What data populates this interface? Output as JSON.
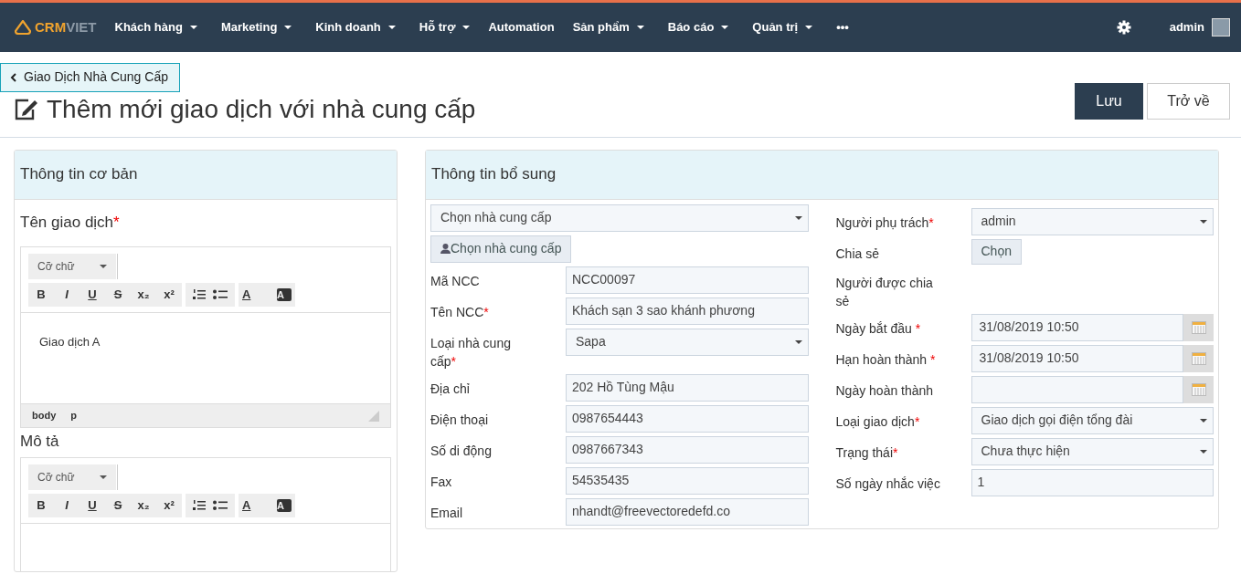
{
  "navbar": {
    "logo": {
      "primary": "CRM",
      "secondary": "VIET"
    },
    "menu": [
      {
        "label": "Khách hàng",
        "dropdown": true
      },
      {
        "label": "Marketing",
        "dropdown": true
      },
      {
        "label": "Kinh doanh",
        "dropdown": true
      },
      {
        "label": "Hỗ trợ",
        "dropdown": true
      },
      {
        "label": "Automation",
        "dropdown": false
      },
      {
        "label": "Sản phẩm",
        "dropdown": true
      },
      {
        "label": "Báo cáo",
        "dropdown": true
      },
      {
        "label": "Quản trị",
        "dropdown": true
      },
      {
        "label": "•••",
        "dropdown": false
      }
    ],
    "user": "admin"
  },
  "breadcrumb": {
    "label": "Giao Dịch Nhà Cung Cấp"
  },
  "page_title": "Thêm mới giao dịch với nhà cung cấp",
  "actions": [
    {
      "label": "Lưu",
      "kind": "primary"
    },
    {
      "label": "Trở về",
      "kind": "default"
    }
  ],
  "basic_panel": {
    "title": "Thông tin cơ bản",
    "editors": [
      {
        "label": "Tên giao dịch",
        "mark": "*",
        "font_size": "Cỡ chữ",
        "format_buttons": [
          "B",
          "I",
          "U",
          "S",
          "x₂",
          "x²"
        ],
        "color_buttons": [
          "A",
          "A"
        ],
        "content": "Giao dịch A",
        "path": [
          "body",
          "p"
        ]
      },
      {
        "label": "Mô tả",
        "font_size": "Cỡ chữ",
        "format_buttons": [
          "B",
          "I",
          "U",
          "S",
          "x₂",
          "x²"
        ],
        "color_buttons": [
          "A",
          "A"
        ]
      }
    ]
  },
  "extra_panel": {
    "title": "Thông tin bổ sung",
    "supplier_select": "Chọn nhà cung cấp",
    "supplier_button": "Chọn nhà cung cấp",
    "left_fields": [
      {
        "label": "Mã NCC",
        "kind": "text",
        "value": "NCC00097"
      },
      {
        "label": "Tên NCC",
        "mark": "*",
        "kind": "text",
        "value": "Khách sạn 3 sao khánh phương"
      },
      {
        "label": "Loại nhà cung cấp",
        "mark": "*",
        "kind": "select",
        "value": "Sapa"
      },
      {
        "label": "Địa chỉ",
        "kind": "text",
        "value": "202 Hồ Tùng Mậu"
      },
      {
        "label": "Điện thoại",
        "kind": "text",
        "value": "0987654443"
      },
      {
        "label": "Số di động",
        "kind": "text",
        "value": "0987667343"
      },
      {
        "label": "Fax",
        "kind": "text",
        "value": "54535435"
      },
      {
        "label": "Email",
        "kind": "text",
        "value": "nhandt@freevectoredefd.co"
      }
    ],
    "right_fields": [
      {
        "label": "Người phụ trách",
        "mark": "*",
        "kind": "select",
        "value": "admin"
      },
      {
        "label": "Chia sẻ",
        "kind": "button",
        "value": "Chọn"
      },
      {
        "label": "Người được chia sẻ",
        "kind": "none"
      },
      {
        "label": "Ngày bắt đầu",
        "mark": " *",
        "kind": "date",
        "value": "31/08/2019 10:50"
      },
      {
        "label": "Hạn hoàn thành",
        "mark": " *",
        "kind": "date",
        "value": "31/08/2019 10:50"
      },
      {
        "label": "Ngày hoàn thành",
        "kind": "date"
      },
      {
        "label": "Loại giao dịch",
        "mark": "*",
        "kind": "select",
        "value": "Giao dịch gọi điện tổng đài"
      },
      {
        "label": "Trạng thái",
        "mark": "*",
        "kind": "select",
        "value": "Chưa thực hiện"
      },
      {
        "label": "Số ngày nhắc việc",
        "kind": "text",
        "value": "1"
      }
    ]
  }
}
